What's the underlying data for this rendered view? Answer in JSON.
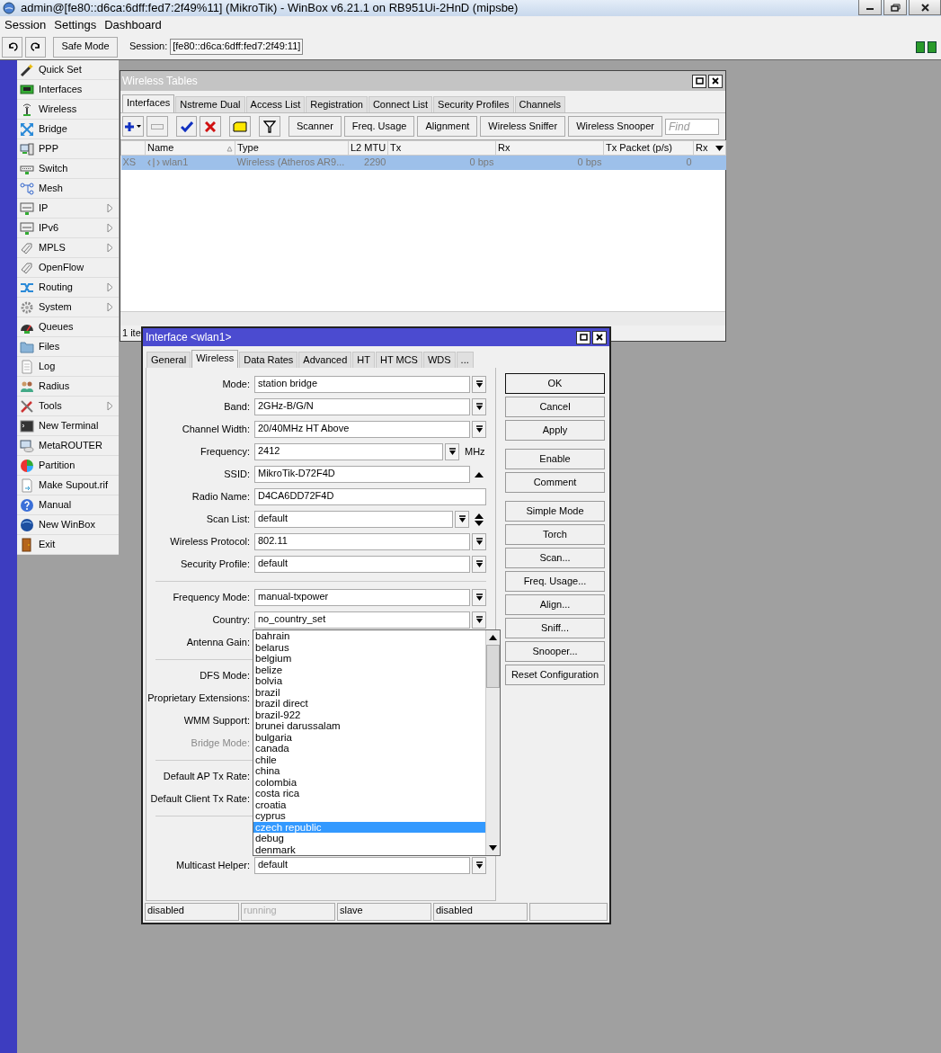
{
  "window": {
    "title": "admin@[fe80::d6ca:6dff:fed7:2f49%11] (MikroTik) - WinBox v6.21.1 on RB951Ui-2HnD (mipsbe)"
  },
  "menu": [
    "Session",
    "Settings",
    "Dashboard"
  ],
  "toolbar": {
    "safe_mode": "Safe Mode",
    "session_label": "Session:",
    "session_value": "[fe80::d6ca:6dff:fed7:2f49:11]"
  },
  "sidebar": {
    "items": [
      {
        "label": "Quick Set",
        "submenu": false
      },
      {
        "label": "Interfaces",
        "submenu": false
      },
      {
        "label": "Wireless",
        "submenu": false
      },
      {
        "label": "Bridge",
        "submenu": false
      },
      {
        "label": "PPP",
        "submenu": false
      },
      {
        "label": "Switch",
        "submenu": false
      },
      {
        "label": "Mesh",
        "submenu": false
      },
      {
        "label": "IP",
        "submenu": true
      },
      {
        "label": "IPv6",
        "submenu": true
      },
      {
        "label": "MPLS",
        "submenu": true
      },
      {
        "label": "OpenFlow",
        "submenu": false
      },
      {
        "label": "Routing",
        "submenu": true
      },
      {
        "label": "System",
        "submenu": true
      },
      {
        "label": "Queues",
        "submenu": false
      },
      {
        "label": "Files",
        "submenu": false
      },
      {
        "label": "Log",
        "submenu": false
      },
      {
        "label": "Radius",
        "submenu": false
      },
      {
        "label": "Tools",
        "submenu": true
      },
      {
        "label": "New Terminal",
        "submenu": false
      },
      {
        "label": "MetaROUTER",
        "submenu": false
      },
      {
        "label": "Partition",
        "submenu": false
      },
      {
        "label": "Make Supout.rif",
        "submenu": false
      },
      {
        "label": "Manual",
        "submenu": false
      },
      {
        "label": "New WinBox",
        "submenu": false
      },
      {
        "label": "Exit",
        "submenu": false
      }
    ]
  },
  "wireless_tables": {
    "title": "Wireless Tables",
    "tabs": [
      {
        "label": "Interfaces",
        "selected": true
      },
      {
        "label": "Nstreme Dual",
        "selected": false
      },
      {
        "label": "Access List",
        "selected": false
      },
      {
        "label": "Registration",
        "selected": false
      },
      {
        "label": "Connect List",
        "selected": false
      },
      {
        "label": "Security Profiles",
        "selected": false
      },
      {
        "label": "Channels",
        "selected": false
      }
    ],
    "buttons": [
      "Scanner",
      "Freq. Usage",
      "Alignment",
      "Wireless Sniffer",
      "Wireless Snooper"
    ],
    "find": {
      "placeholder": "Find"
    },
    "columns": [
      "Name",
      "Type",
      "L2 MTU",
      "Tx",
      "Rx",
      "Tx Packet (p/s)",
      "Rx"
    ],
    "rows": [
      {
        "flags": "XS",
        "cells": [
          "wlan1",
          "Wireless (Atheros AR9...",
          "2290",
          "0 bps",
          "0 bps",
          "0"
        ],
        "selected": true
      }
    ],
    "status": "1 ite"
  },
  "interface_dialog": {
    "title": "Interface <wlan1>",
    "tabs": [
      {
        "label": "General",
        "selected": false
      },
      {
        "label": "Wireless",
        "selected": true
      },
      {
        "label": "Data Rates",
        "selected": false
      },
      {
        "label": "Advanced",
        "selected": false
      },
      {
        "label": "HT",
        "selected": false
      },
      {
        "label": "HT MCS",
        "selected": false
      },
      {
        "label": "WDS",
        "selected": false
      },
      {
        "label": "...",
        "selected": false
      }
    ],
    "fields": [
      {
        "kind": "dropdown",
        "label": "Mode:",
        "value": "station bridge",
        "disabled": false
      },
      {
        "kind": "dropdown",
        "label": "Band:",
        "value": "2GHz-B/G/N",
        "disabled": false
      },
      {
        "kind": "dropdown",
        "label": "Channel Width:",
        "value": "20/40MHz HT Above",
        "disabled": false
      },
      {
        "kind": "dropdown",
        "label": "Frequency:",
        "value": "2412",
        "unit": "MHz",
        "disabled": false
      },
      {
        "kind": "collapsible",
        "label": "SSID:",
        "value": "MikroTik-D72F4D",
        "disabled": false
      },
      {
        "kind": "text",
        "label": "Radio Name:",
        "value": "D4CA6DD72F4D",
        "disabled": false
      },
      {
        "kind": "multi",
        "label": "Scan List:",
        "value": "default",
        "disabled": false
      },
      {
        "kind": "dropdown",
        "label": "Wireless Protocol:",
        "value": "802.11",
        "disabled": false
      },
      {
        "kind": "dropdown",
        "label": "Security Profile:",
        "value": "default",
        "disabled": false
      },
      {
        "kind": "separator"
      },
      {
        "kind": "dropdown",
        "label": "Frequency Mode:",
        "value": "manual-txpower",
        "disabled": false
      },
      {
        "kind": "dropdown",
        "label": "Country:",
        "value": "no_country_set",
        "disabled": false
      },
      {
        "kind": "covered",
        "label": "Antenna Gain:",
        "disabled": false
      },
      {
        "kind": "separator"
      },
      {
        "kind": "covered",
        "label": "DFS Mode:",
        "disabled": false
      },
      {
        "kind": "covered",
        "label": "Proprietary Extensions:",
        "disabled": false
      },
      {
        "kind": "covered",
        "label": "WMM Support:",
        "disabled": false
      },
      {
        "kind": "covered",
        "label": "Bridge Mode:",
        "disabled": true
      },
      {
        "kind": "separator"
      },
      {
        "kind": "covered",
        "label": "Default AP Tx Rate:",
        "disabled": false
      },
      {
        "kind": "covered",
        "label": "Default Client Tx Rate:",
        "disabled": false
      },
      {
        "kind": "separator"
      },
      {
        "kind": "dropdown",
        "label": "Multicast Helper:",
        "value": "default",
        "disabled": false
      }
    ],
    "country_list": [
      {
        "label": "bahrain",
        "selected": false
      },
      {
        "label": "belarus",
        "selected": false
      },
      {
        "label": "belgium",
        "selected": false
      },
      {
        "label": "belize",
        "selected": false
      },
      {
        "label": "bolvia",
        "selected": false
      },
      {
        "label": "brazil",
        "selected": false
      },
      {
        "label": "brazil direct",
        "selected": false
      },
      {
        "label": "brazil-922",
        "selected": false
      },
      {
        "label": "brunei darussalam",
        "selected": false
      },
      {
        "label": "bulgaria",
        "selected": false
      },
      {
        "label": "canada",
        "selected": false
      },
      {
        "label": "chile",
        "selected": false
      },
      {
        "label": "china",
        "selected": false
      },
      {
        "label": "colombia",
        "selected": false
      },
      {
        "label": "costa rica",
        "selected": false
      },
      {
        "label": "croatia",
        "selected": false
      },
      {
        "label": "cyprus",
        "selected": false
      },
      {
        "label": "czech republic",
        "selected": true
      },
      {
        "label": "debug",
        "selected": false
      },
      {
        "label": "denmark",
        "selected": false
      }
    ],
    "button_groups": [
      [
        {
          "label": "OK",
          "default": true
        },
        {
          "label": "Cancel",
          "default": false
        },
        {
          "label": "Apply",
          "default": false
        }
      ],
      [
        {
          "label": "Enable",
          "default": false
        },
        {
          "label": "Comment",
          "default": false
        }
      ],
      [
        {
          "label": "Simple Mode",
          "default": false
        },
        {
          "label": "Torch",
          "default": false
        },
        {
          "label": "Scan...",
          "default": false
        },
        {
          "label": "Freq. Usage...",
          "default": false
        },
        {
          "label": "Align...",
          "default": false
        },
        {
          "label": "Sniff...",
          "default": false
        },
        {
          "label": "Snooper...",
          "default": false
        },
        {
          "label": "Reset Configuration",
          "default": false
        }
      ]
    ],
    "status": [
      {
        "text": "disabled",
        "disabled": false
      },
      {
        "text": "running",
        "disabled": true
      },
      {
        "text": "slave",
        "disabled": false
      },
      {
        "text": "disabled",
        "disabled": false
      }
    ]
  }
}
